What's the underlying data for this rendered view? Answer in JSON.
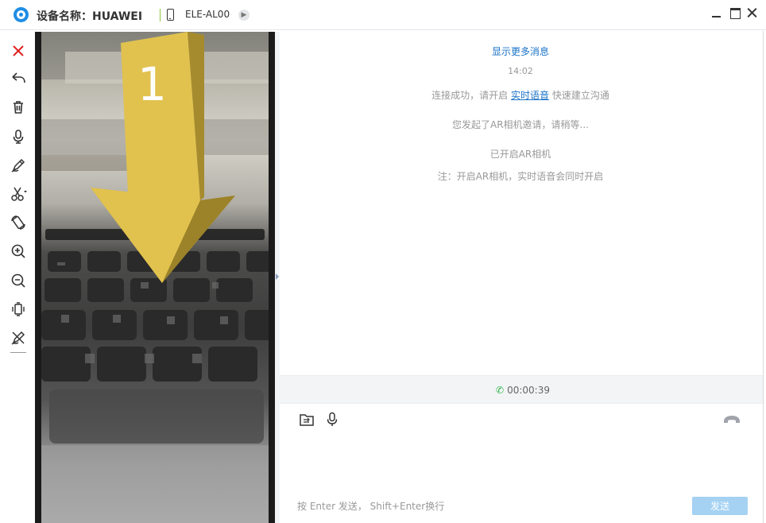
{
  "titlebar": {
    "device_label": "设备名称：HUAWEI",
    "model": "ELE-AL00"
  },
  "camera": {
    "overlay_number": "1"
  },
  "chat": {
    "show_more": "显示更多消息",
    "time": "14:02",
    "connect_prefix": "连接成功，请开启",
    "connect_link": "实时语音",
    "connect_suffix": "快速建立沟通",
    "ar_invite": "您发起了AR相机邀请，请稍等...",
    "ar_opened": "已开启AR相机",
    "ar_note": "注：开启AR相机，实时语音会同时开启"
  },
  "call": {
    "duration": "00:00:39"
  },
  "input": {
    "hint": "按 Enter 发送， Shift+Enter换行",
    "send_label": "发送"
  },
  "colors": {
    "accent": "#1a73c7",
    "call_green": "#2db34a",
    "close_red": "#e02020",
    "send_disabled": "#a5d2f3",
    "arrow_yellow": "#e1c24e"
  },
  "icons": {
    "toolbar": [
      "close-icon",
      "undo-icon",
      "trash-icon",
      "microphone-icon",
      "pen-icon",
      "scissors-icon",
      "rotate-icon",
      "zoom-in-icon",
      "zoom-out-icon",
      "vibrate-icon",
      "no-pen-icon"
    ],
    "input": [
      "folder-icon",
      "microphone-icon"
    ],
    "call": [
      "hangup-icon"
    ]
  }
}
